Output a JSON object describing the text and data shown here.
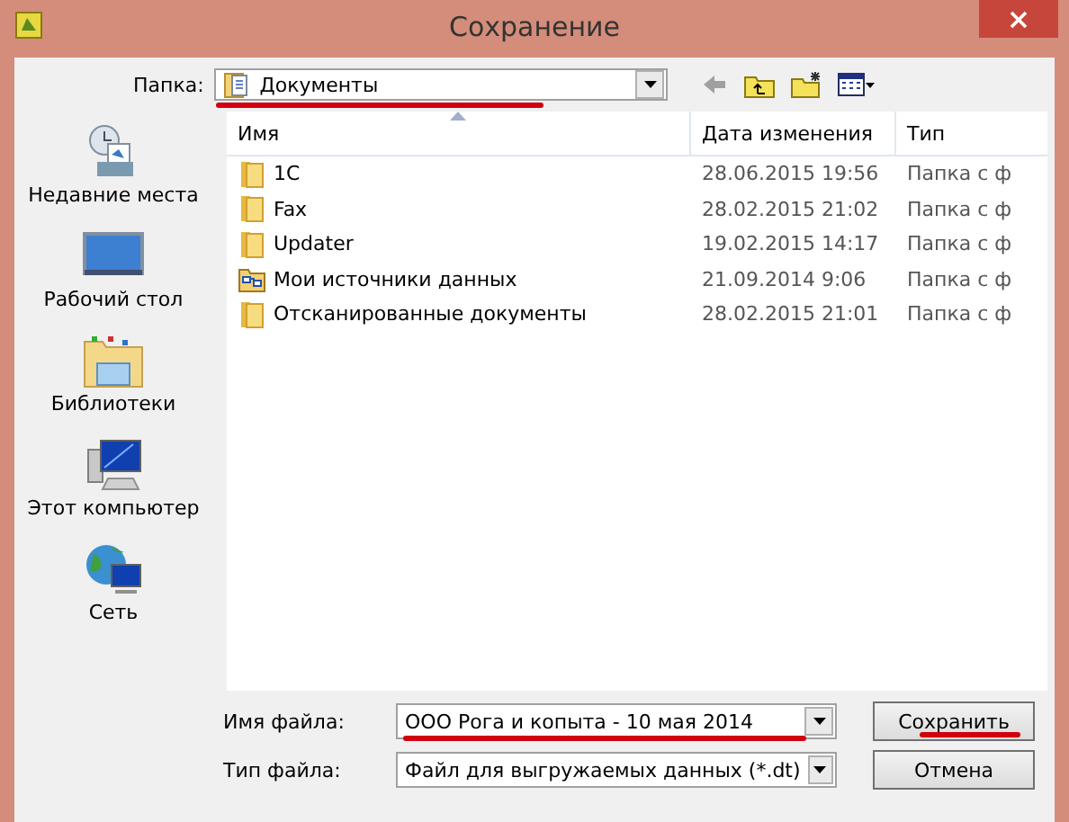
{
  "window": {
    "title": "Сохранение"
  },
  "folder_bar": {
    "label": "Папка:",
    "value": "Документы"
  },
  "places": [
    {
      "label": "Недавние места",
      "kind": "recent"
    },
    {
      "label": "Рабочий стол",
      "kind": "desktop"
    },
    {
      "label": "Библиотеки",
      "kind": "libraries"
    },
    {
      "label": "Этот компьютер",
      "kind": "computer"
    },
    {
      "label": "Сеть",
      "kind": "network"
    }
  ],
  "table": {
    "columns": [
      "Имя",
      "Дата изменения",
      "Тип"
    ],
    "rows": [
      {
        "name": "1C",
        "kind": "folder",
        "date": "28.06.2015 19:56",
        "type": "Папка с ф"
      },
      {
        "name": "Fax",
        "kind": "folder",
        "date": "28.02.2015 21:02",
        "type": "Папка с ф"
      },
      {
        "name": "Updater",
        "kind": "folder",
        "date": "19.02.2015 14:17",
        "type": "Папка с ф"
      },
      {
        "name": "Мои источники данных",
        "kind": "datasource",
        "date": "21.09.2014 9:06",
        "type": "Папка с ф"
      },
      {
        "name": "Отсканированные документы",
        "kind": "folder",
        "date": "28.02.2015 21:01",
        "type": "Папка с ф"
      }
    ]
  },
  "file_name": {
    "label": "Имя файла:",
    "value": "ООО Рога и копыта - 10 мая 2014"
  },
  "file_type": {
    "label": "Тип файла:",
    "value": "Файл для выгружаемых данных (*.dt)"
  },
  "buttons": [
    "Сохранить",
    "Отмена"
  ]
}
